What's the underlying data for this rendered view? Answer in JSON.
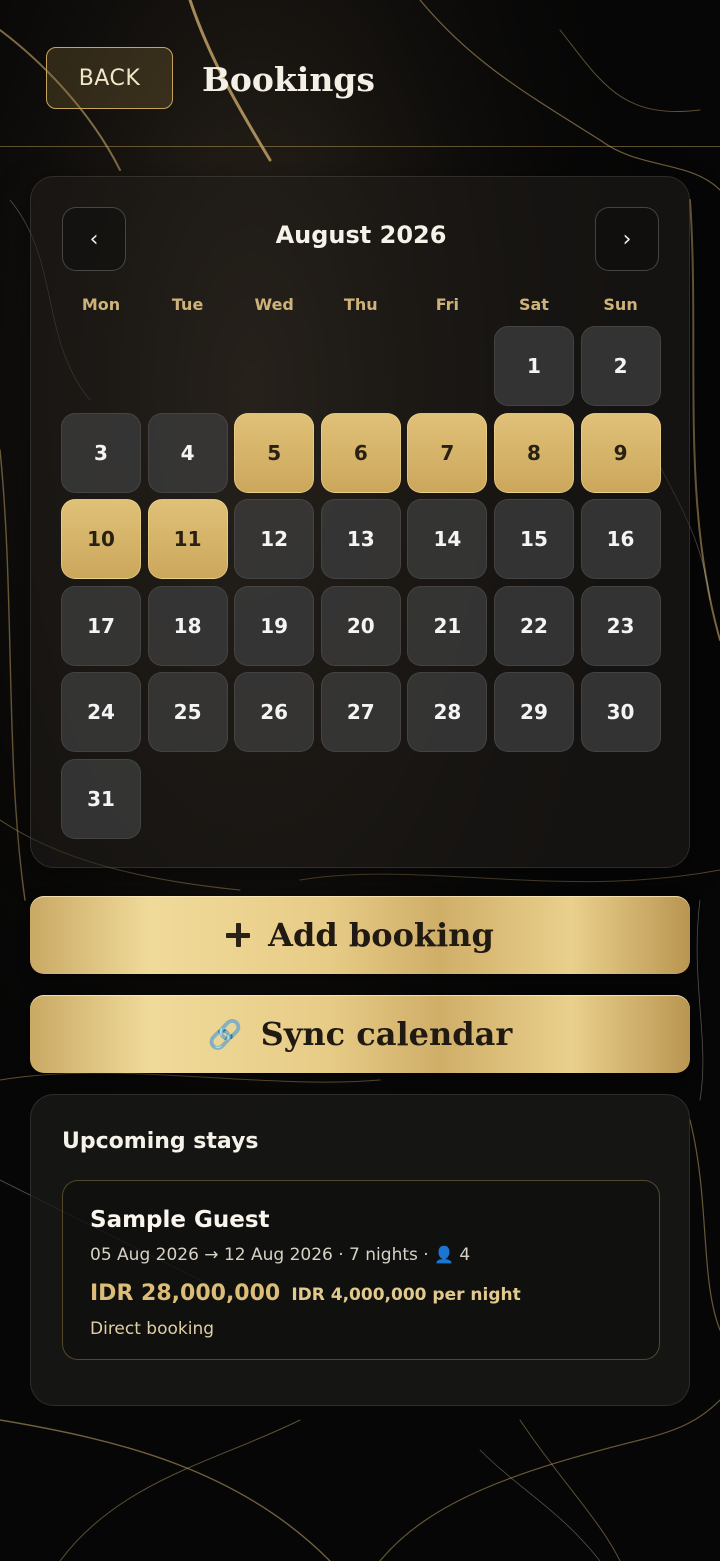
{
  "header": {
    "back_label": "BACK",
    "title": "Bookings"
  },
  "calendar": {
    "month_label": "August 2026",
    "prev_glyph": "‹",
    "next_glyph": "›",
    "weekdays": [
      "Mon",
      "Tue",
      "Wed",
      "Thu",
      "Fri",
      "Sat",
      "Sun"
    ],
    "first_weekday_index": 5,
    "days_in_month": 31,
    "booked_days": [
      5,
      6,
      7,
      8,
      9,
      10,
      11
    ]
  },
  "actions": {
    "add_label": "Add booking",
    "sync_label": "Sync calendar",
    "sync_icon_glyph": "🔗"
  },
  "upcoming": {
    "title": "Upcoming stays",
    "stays": [
      {
        "guest": "Sample Guest",
        "dates": "05 Aug 2026 → 12 Aug 2026 · 7 nights ·",
        "guests": "4",
        "total": "IDR 28,000,000",
        "per_night": "IDR 4,000,000 per night",
        "source": "Direct booking"
      }
    ]
  },
  "colors": {
    "gold": "#d8b96e",
    "background": "#050505",
    "day_cell": "#3a3a3a"
  }
}
